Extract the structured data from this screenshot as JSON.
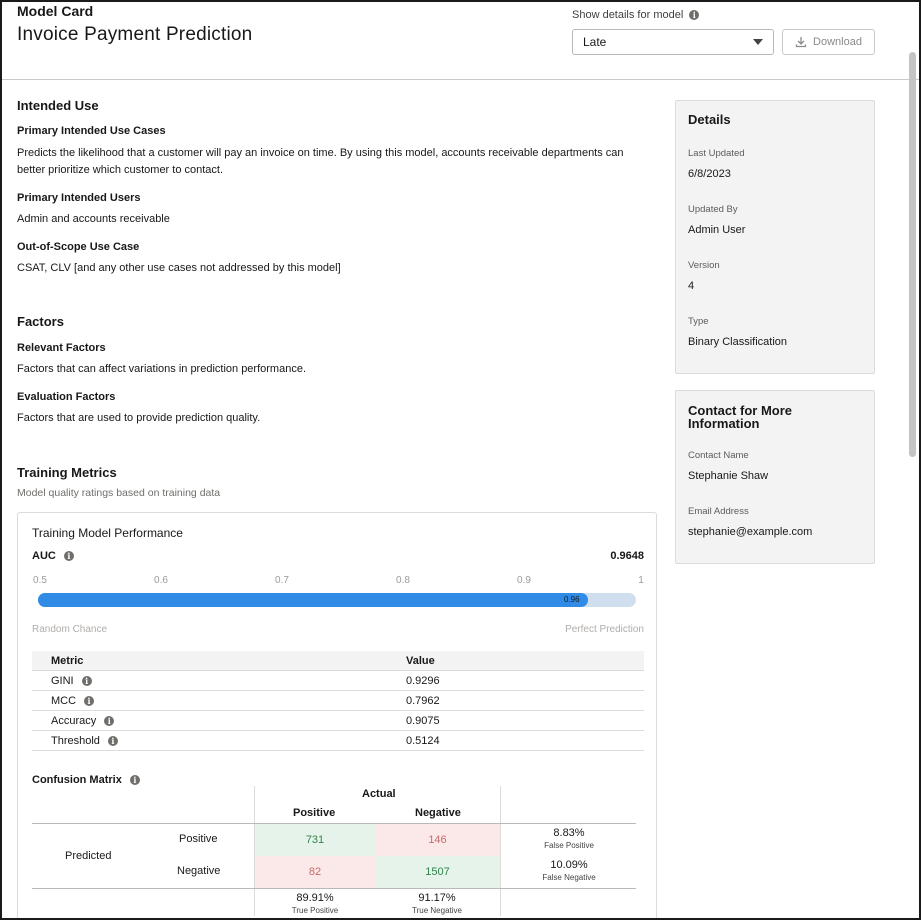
{
  "header": {
    "eyebrow": "Model Card",
    "title": "Invoice Payment Prediction",
    "show_details_label": "Show details for model",
    "selected_model": "Late",
    "download_label": "Download"
  },
  "intended_use": {
    "heading": "Intended Use",
    "use_cases_heading": "Primary Intended Use Cases",
    "use_cases_text": "Predicts the likelihood that a customer will pay an invoice on time. By using this model, accounts receivable departments can better prioritize which customer to contact.",
    "users_heading": "Primary Intended Users",
    "users_text": "Admin and accounts receivable",
    "oos_heading": "Out-of-Scope Use Case",
    "oos_text": "CSAT, CLV [and any other use cases not addressed by this model]"
  },
  "factors": {
    "heading": "Factors",
    "relevant_heading": "Relevant Factors",
    "relevant_text": "Factors that can affect variations in prediction performance.",
    "evaluation_heading": "Evaluation Factors",
    "evaluation_text": "Factors that are used to provide prediction quality."
  },
  "training": {
    "heading": "Training Metrics",
    "subtitle": "Model quality ratings based on training data",
    "panel_title": "Training Model Performance",
    "auc_label": "AUC",
    "auc_value": "0.9648",
    "auc_fraction": 0.96,
    "auc_bar_label": "0.96",
    "scale_ticks": [
      "0.5",
      "0.6",
      "0.7",
      "0.8",
      "0.9",
      "1"
    ],
    "range_left": "Random Chance",
    "range_right": "Perfect Prediction",
    "table_headers": {
      "metric": "Metric",
      "value": "Value"
    },
    "metrics": [
      {
        "name": "GINI",
        "value": "0.9296"
      },
      {
        "name": "MCC",
        "value": "0.7962"
      },
      {
        "name": "Accuracy",
        "value": "0.9075"
      },
      {
        "name": "Threshold",
        "value": "0.5124"
      }
    ],
    "confusion": {
      "title": "Confusion Matrix",
      "actual_label": "Actual",
      "predicted_label": "Predicted",
      "col_positive": "Positive",
      "col_negative": "Negative",
      "row_positive": "Positive",
      "row_negative": "Negative",
      "tp": "731",
      "fp": "146",
      "fn": "82",
      "tn": "1507",
      "fp_rate": "8.83%",
      "fp_rate_label": "False Positive",
      "fn_rate": "10.09%",
      "fn_rate_label": "False Negative",
      "tp_rate": "89.91%",
      "tp_rate_label": "True Positive",
      "tn_rate": "91.17%",
      "tn_rate_label": "True Negative"
    }
  },
  "details": {
    "heading": "Details",
    "last_updated_label": "Last Updated",
    "last_updated": "6/8/2023",
    "updated_by_label": "Updated By",
    "updated_by": "Admin User",
    "version_label": "Version",
    "version": "4",
    "type_label": "Type",
    "type": "Binary Classification"
  },
  "contact": {
    "heading": "Contact for More Information",
    "name_label": "Contact Name",
    "name": "Stephanie Shaw",
    "email_label": "Email Address",
    "email": "stephanie@example.com"
  },
  "colors": {
    "accent": "#2f8be6",
    "true_cell": "#e6f3ea",
    "false_cell": "#fbe9e9",
    "true_text": "#2e844a",
    "false_text": "#c96a6a"
  },
  "icons": [
    "info-icon",
    "chevron-down-icon",
    "download-icon"
  ]
}
